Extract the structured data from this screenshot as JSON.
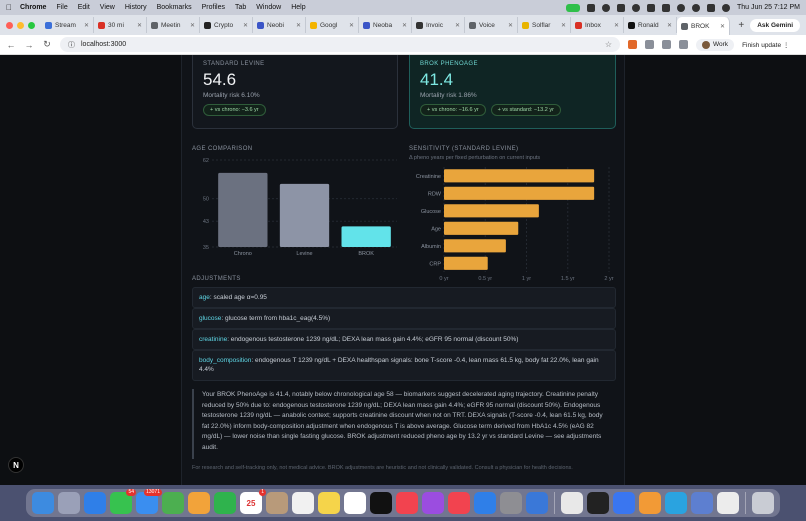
{
  "menubar": {
    "app": "Chrome",
    "items": [
      "File",
      "Edit",
      "View",
      "History",
      "Bookmarks",
      "Profiles",
      "Tab",
      "Window",
      "Help"
    ],
    "clock": "Thu Jun 25  7:12 PM"
  },
  "tabs": [
    {
      "label": "Stream",
      "color": "#3b6fd9"
    },
    {
      "label": "30 mi",
      "color": "#d93025"
    },
    {
      "label": "Meetin",
      "color": "#5f6368"
    },
    {
      "label": "Crypto",
      "color": "#222222"
    },
    {
      "label": "Neobi",
      "color": "#3b55c7"
    },
    {
      "label": "Googl",
      "color": "#f4b400"
    },
    {
      "label": "Neoba",
      "color": "#3b55c7"
    },
    {
      "label": "Invoic",
      "color": "#333333"
    },
    {
      "label": "Voice",
      "color": "#5f6368"
    },
    {
      "label": "Solflar",
      "color": "#e8b400"
    },
    {
      "label": "Inbox",
      "color": "#d93025"
    },
    {
      "label": "Ronald",
      "color": "#111111"
    },
    {
      "label": "BROK",
      "color": "#5f6368",
      "active": true
    }
  ],
  "ask_gemini": "Ask Gemini",
  "toolbar": {
    "url": "localhost:3000",
    "profile": "Work",
    "finish_update": "Finish update"
  },
  "cards": {
    "standard": {
      "label": "STANDARD LEVINE",
      "value": "54.6",
      "risk": "Mortality risk 6.10%",
      "pills": [
        "+ vs chrono: −3.6 yr"
      ]
    },
    "brok": {
      "label": "BROK PHENOAGE",
      "value": "41.4",
      "risk": "Mortality risk 1.86%",
      "pills": [
        "+ vs chrono: −16.6 yr",
        "+ vs standard: −13.2 yr"
      ]
    }
  },
  "age_comparison": {
    "title": "AGE COMPARISON"
  },
  "sensitivity": {
    "title": "SENSITIVITY (STANDARD LEVINE)",
    "subtitle": "Δ pheno years per fixed perturbation on current inputs"
  },
  "chart_data": [
    {
      "type": "bar",
      "title": "AGE COMPARISON",
      "categories": [
        "Chrono",
        "Levine",
        "BROK"
      ],
      "values": [
        58,
        54.6,
        41.4
      ],
      "colors": [
        "#6b7180",
        "#8d94a6",
        "#62e3ea"
      ],
      "yticks": [
        "62",
        "50",
        "43",
        "35"
      ],
      "ylim": [
        35,
        62
      ],
      "grid": true
    },
    {
      "type": "bar",
      "orientation": "horizontal",
      "title": "SENSITIVITY (STANDARD LEVINE)",
      "categories": [
        "Creatinine",
        "RDW",
        "Glucose",
        "Age",
        "Albumin",
        "CRP"
      ],
      "values": [
        1.82,
        1.82,
        1.15,
        0.9,
        0.75,
        0.53
      ],
      "color": "#e9a53c",
      "xticks": [
        "0 yr",
        "0.5 yr",
        "1 yr",
        "1.5 yr",
        "2 yr"
      ],
      "xlim": [
        0,
        2
      ],
      "grid": true
    }
  ],
  "adjustments": {
    "title": "ADJUSTMENTS",
    "rows": [
      {
        "key": "age",
        "text": ": scaled age α=0.95"
      },
      {
        "key": "glucose",
        "text": ": glucose term from hba1c_eag(4.5%)"
      },
      {
        "key": "creatinine",
        "text": ": endogenous testosterone 1239 ng/dL; DEXA lean mass gain 4.4%; eGFR 95 normal (discount 50%)"
      },
      {
        "key": "body_composition",
        "text": ": endogenous T 1239 ng/dL + DEXA healthspan signals: bone T-score -0.4, lean mass 61.5 kg, body fat 22.0%, lean gain 4.4%"
      }
    ]
  },
  "summary": "Your BROK PhenoAge is 41.4, notably below chronological age 58 — biomarkers suggest decelerated aging trajectory. Creatinine penalty reduced by 50% due to: endogenous testosterone 1239 ng/dL; DEXA lean mass gain 4.4%; eGFR 95 normal (discount 50%). Endogenous testosterone 1239 ng/dL — anabolic context; supports creatinine discount when not on TRT. DEXA signals (T-score -0.4, lean 61.5 kg, body fat 22.0%) inform body-composition adjustment when endogenous T is above average. Glucose term derived from HbA1c 4.5% (eAG 82 mg/dL) — lower noise than single fasting glucose. BROK adjustment reduced pheno age by 13.2 yr vs standard Levine — see adjustments audit.",
  "disclaimer": "For research and self-tracking only, not medical advice. BROK adjustments are heuristic and not clinically validated. Consult a physician for health decisions.",
  "n_badge": "N",
  "dock": [
    {
      "name": "finder",
      "color": "#3d8be0"
    },
    {
      "name": "launchpad",
      "color": "#9aa0b8"
    },
    {
      "name": "safari",
      "color": "#2f7fe8"
    },
    {
      "name": "messages",
      "color": "#37c24f",
      "badge": "54"
    },
    {
      "name": "mail",
      "color": "#3a8ef0",
      "badge": "13071"
    },
    {
      "name": "maps",
      "color": "#4caf50"
    },
    {
      "name": "photos",
      "color": "#f2a33a"
    },
    {
      "name": "facetime",
      "color": "#2fb34d"
    },
    {
      "name": "calendar",
      "color": "#ffffff",
      "badge": "1",
      "text": "25"
    },
    {
      "name": "contacts",
      "color": "#b89a7a"
    },
    {
      "name": "reminders",
      "color": "#f1f1f1"
    },
    {
      "name": "notes",
      "color": "#f5d44a"
    },
    {
      "name": "freeform",
      "color": "#ffffff"
    },
    {
      "name": "tv",
      "color": "#111111"
    },
    {
      "name": "music",
      "color": "#f2434f"
    },
    {
      "name": "podcasts",
      "color": "#9b4de0"
    },
    {
      "name": "news",
      "color": "#f2434f"
    },
    {
      "name": "app-store",
      "color": "#2f7fe8"
    },
    {
      "name": "settings",
      "color": "#8e8e93"
    },
    {
      "name": "preview",
      "color": "#3a78d8"
    },
    {
      "name": "chrome",
      "color": "#e8e8e8"
    },
    {
      "name": "terminal",
      "color": "#222222"
    },
    {
      "name": "signal",
      "color": "#3a76f0"
    },
    {
      "name": "sublime",
      "color": "#f29a36"
    },
    {
      "name": "telegram",
      "color": "#2aa3e0"
    },
    {
      "name": "finder-drive",
      "color": "#5d7fd0"
    },
    {
      "name": "github",
      "color": "#ececec"
    },
    {
      "name": "trash",
      "color": "#c9ccd4"
    }
  ]
}
